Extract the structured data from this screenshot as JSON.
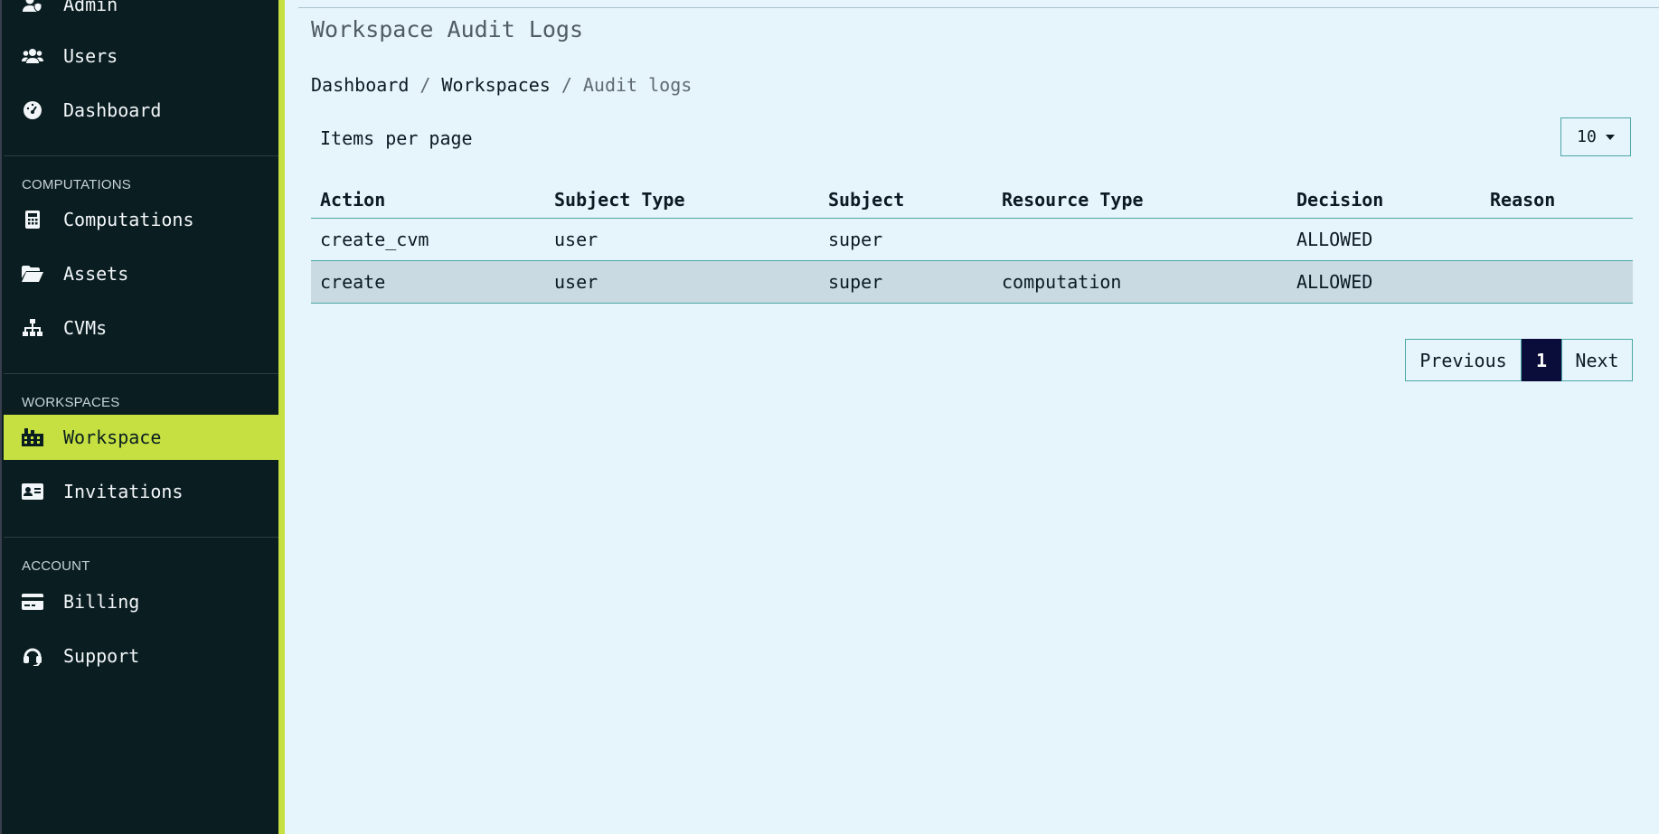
{
  "sidebar": {
    "items": [
      {
        "label": "Admin",
        "icon": "user-shield-icon"
      },
      {
        "label": "Users",
        "icon": "users-icon"
      },
      {
        "label": "Dashboard",
        "icon": "gauge-icon"
      },
      {
        "label": "Computations",
        "icon": "calculator-icon"
      },
      {
        "label": "Assets",
        "icon": "folder-open-icon"
      },
      {
        "label": "CVMs",
        "icon": "sitemap-icon"
      },
      {
        "label": "Workspace",
        "icon": "building-icon"
      },
      {
        "label": "Invitations",
        "icon": "id-card-icon"
      },
      {
        "label": "Billing",
        "icon": "credit-card-icon"
      },
      {
        "label": "Support",
        "icon": "headset-icon"
      }
    ],
    "sections": {
      "computations": "COMPUTATIONS",
      "workspaces": "WORKSPACES",
      "account": "ACCOUNT"
    },
    "active_item": "Workspace",
    "accent_color": "#c5e040",
    "background_color": "#0a1d21"
  },
  "main": {
    "title": "Workspace Audit Logs",
    "breadcrumb": {
      "items": [
        "Dashboard",
        "Workspaces",
        "Audit logs"
      ],
      "separator": "/"
    },
    "items_per_page": {
      "label": "Items per page",
      "value": "10"
    },
    "table": {
      "columns": [
        "Action",
        "Subject Type",
        "Subject",
        "Resource Type",
        "Decision",
        "Reason"
      ],
      "rows": [
        [
          "create_cvm",
          "user",
          "super",
          "",
          "ALLOWED",
          ""
        ],
        [
          "create",
          "user",
          "super",
          "computation",
          "ALLOWED",
          ""
        ]
      ]
    },
    "pagination": {
      "previous": "Previous",
      "current_page": "1",
      "next": "Next"
    }
  }
}
